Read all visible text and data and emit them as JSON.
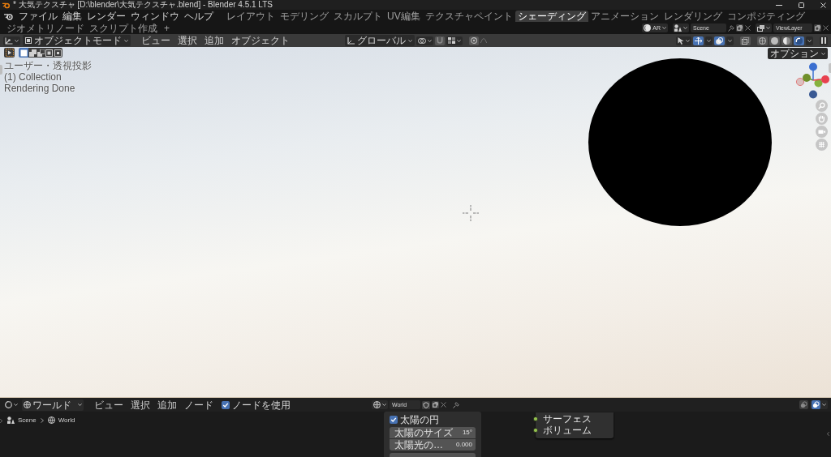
{
  "title_bar": {
    "title": "* 大気テクスチャ [D:\\blender\\大気テクスチャ.blend] - Blender 4.5.1 LTS"
  },
  "top_bar": {
    "menus": [
      "ファイル",
      "編集",
      "レンダー",
      "ウィンドウ",
      "ヘルプ"
    ],
    "workspaces": [
      {
        "label": "レイアウト",
        "selected": false
      },
      {
        "label": "モデリング",
        "selected": false
      },
      {
        "label": "スカルプト",
        "selected": false
      },
      {
        "label": "UV編集",
        "selected": false
      },
      {
        "label": "テクスチャペイント",
        "selected": false
      },
      {
        "label": "シェーディング",
        "selected": true
      },
      {
        "label": "アニメーション",
        "selected": false
      },
      {
        "label": "レンダリング",
        "selected": false
      },
      {
        "label": "コンポジティング",
        "selected": false
      },
      {
        "label": "ジオメトリノード",
        "selected": false
      },
      {
        "label": "スクリプト作成",
        "selected": false
      }
    ],
    "add_workspace": "+",
    "addon": "AR",
    "scene": "Scene",
    "view_layer": "ViewLayer"
  },
  "viewport_header": {
    "mode": "オブジェクトモード",
    "menus": [
      "ビュー",
      "選択",
      "追加",
      "オブジェクト"
    ],
    "orientation": "グローバル",
    "snap": {
      "on": false
    },
    "proportional_editing": {
      "on": false
    },
    "gizmos": {
      "on": true
    },
    "overlays": {
      "on": true
    },
    "xray": {
      "on": false
    },
    "shading": [
      {
        "kind": "wireframe",
        "selected": false
      },
      {
        "kind": "solid",
        "selected": false
      },
      {
        "kind": "material",
        "selected": false
      },
      {
        "kind": "rendered",
        "selected": true
      }
    ]
  },
  "viewport": {
    "select_modes": [
      {
        "kind": "set",
        "selected": true
      },
      {
        "kind": "extend",
        "selected": false
      },
      {
        "kind": "subtract",
        "selected": false
      },
      {
        "kind": "invert",
        "selected": false
      },
      {
        "kind": "intersect",
        "selected": false
      }
    ],
    "overlay_text": [
      "ユーザー・透視投影",
      "(1) Collection",
      "Rendering Done"
    ],
    "options": "オプション"
  },
  "node_editor": {
    "header": {
      "shader_type": "ワールド",
      "menus": [
        "ビュー",
        "選択",
        "追加",
        "ノード"
      ],
      "use_nodes": {
        "label": "ノードを使用",
        "checked": true
      },
      "world": "World"
    },
    "breadcrumbs": [
      {
        "kind": "scene",
        "label": "Scene"
      },
      {
        "kind": "world",
        "label": "World"
      }
    ],
    "sky_panel": {
      "sun_disc": {
        "label": "太陽の円",
        "checked": true
      },
      "fields": [
        {
          "label": "太陽のサイズ",
          "value": "15°"
        },
        {
          "label": "太陽光の…",
          "value": "0.000"
        }
      ]
    },
    "output_node": {
      "sockets": [
        "サーフェス",
        "ボリューム"
      ]
    }
  }
}
